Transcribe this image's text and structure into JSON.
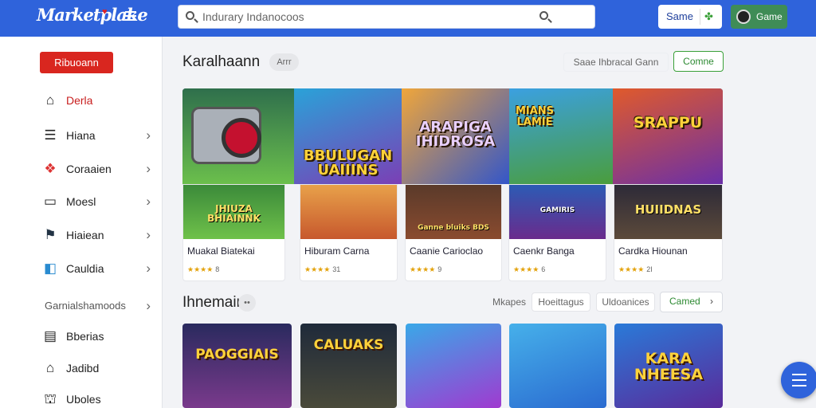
{
  "header": {
    "logo": "Marketplake",
    "search_placeholder": "Indurary Indanocoos",
    "same_label": "Same",
    "game_label": "Game"
  },
  "sidebar": {
    "cta_label": "Ribuoann",
    "items": [
      {
        "label": "Derla",
        "icon": "home-icon"
      },
      {
        "label": "Hiana",
        "icon": "list-icon"
      },
      {
        "label": "Coraaien",
        "icon": "bubbles-icon"
      },
      {
        "label": "Moesl",
        "icon": "box-icon"
      },
      {
        "label": "Hiaiean",
        "icon": "flag-icon"
      },
      {
        "label": "Cauldia",
        "icon": "cube-icon"
      },
      {
        "label": "Garnialshamoods",
        "icon": ""
      },
      {
        "label": "Bberias",
        "icon": "document-icon"
      },
      {
        "label": "Jadibd",
        "icon": "shop-icon"
      },
      {
        "label": "Uboles",
        "icon": "bag-icon"
      }
    ]
  },
  "section1": {
    "title": "Karalhaann",
    "tag": "Arrr",
    "link_label": "Saae Ihbracal Gann",
    "button_label": "Comne",
    "banner_titles": [
      "BBULUGAN UAIIINS",
      "ARAPIGA IHIDROSA",
      "MIANS LAMIE",
      "SRAPPU"
    ],
    "cards": [
      {
        "art_title": "JHIUZA BHIAINNK",
        "name": "Muakal Biatekai",
        "stars": "★★★★",
        "count": "8"
      },
      {
        "art_title": "",
        "name": "Hiburam Carna",
        "stars": "★★★★",
        "count": "31"
      },
      {
        "art_title": "Ganne bluiks BDS",
        "name": "Caanie Carioclao",
        "stars": "★★★★",
        "count": "9"
      },
      {
        "art_title": "GAMIRIS",
        "name": "Caenkr Banga",
        "stars": "★★★★",
        "count": "6"
      },
      {
        "art_title": "HUIIDNAS",
        "name": "Cardka Hiounan",
        "stars": "★★★★",
        "count": "2I"
      }
    ]
  },
  "section2": {
    "title": "Ihnemain",
    "tag": "••",
    "links": [
      "Mkapes",
      "Hoeittagus",
      "Uldoanices"
    ],
    "button_label": "Camed",
    "tiles": [
      "PAOGGIAIS",
      "CALUAKS",
      "",
      "",
      "KARA NHEESA"
    ]
  },
  "colors": {
    "primary": "#2f63db",
    "accent_red": "#d9261f",
    "accent_green": "#3aa038"
  }
}
